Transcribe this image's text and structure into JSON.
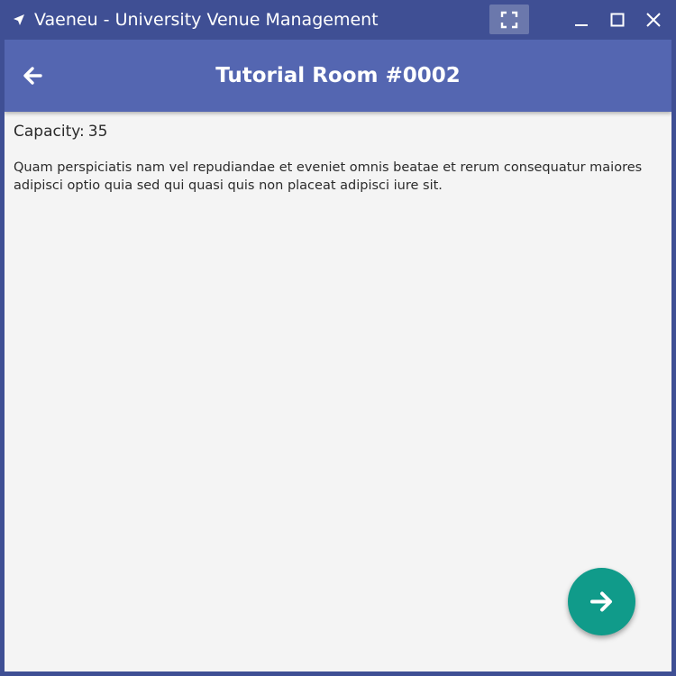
{
  "window": {
    "title": "Vaeneu - University Venue Management",
    "colors": {
      "frame": "#3f4f94",
      "appbar": "#5466b1",
      "background": "#f4f4f4",
      "fab": "#109b8a"
    }
  },
  "titlebar": {
    "app_icon": "navigation-arrow-icon",
    "fullscreen_icon": "fullscreen-icon",
    "minimize_icon": "minimize-icon",
    "maximize_icon": "maximize-icon",
    "close_icon": "close-icon"
  },
  "appbar": {
    "back_icon": "arrow-left-icon",
    "title": "Tutorial Room #0002"
  },
  "room": {
    "capacity_label": "Capacity:",
    "capacity_value": "35",
    "description": "Quam perspiciatis nam vel repudiandae et eveniet omnis beatae et rerum consequatur maiores adipisci optio quia sed qui quasi quis non placeat adipisci iure sit."
  },
  "fab": {
    "icon": "arrow-right-icon"
  }
}
